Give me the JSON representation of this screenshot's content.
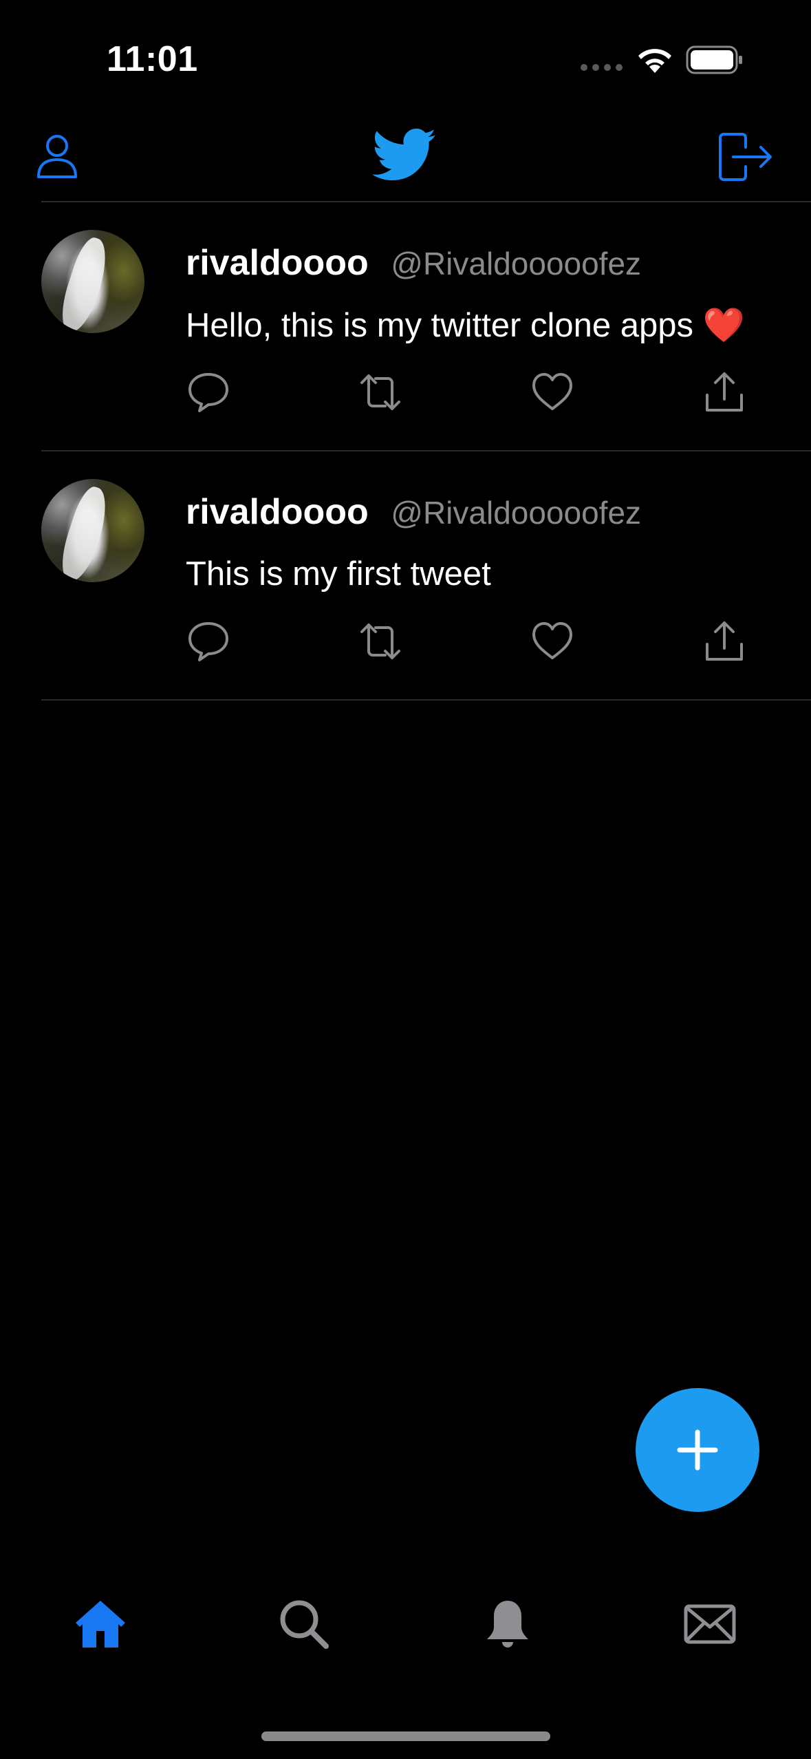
{
  "status_bar": {
    "time": "11:01",
    "icons": [
      "signal-dots-icon",
      "wifi-icon",
      "battery-icon"
    ]
  },
  "top_nav": {
    "left_icon": "profile-icon",
    "center_icon": "twitter-bird-logo",
    "right_icon": "logout-icon",
    "accent_color": "#1d9bf0"
  },
  "tweets": [
    {
      "name": "rivaldoooo",
      "handle": "@Rivaldooooofez",
      "text": "Hello, this is my twitter clone apps ❤️",
      "actions": [
        "comment-icon",
        "retweet-icon",
        "like-icon",
        "share-icon"
      ]
    },
    {
      "name": "rivaldoooo",
      "handle": "@Rivaldooooofez",
      "text": "This is my first tweet",
      "actions": [
        "comment-icon",
        "retweet-icon",
        "like-icon",
        "share-icon"
      ]
    }
  ],
  "compose_button": {
    "icon": "plus-icon",
    "color": "#1d9bf0"
  },
  "tab_bar": {
    "tabs": [
      {
        "icon": "home-icon",
        "active": true
      },
      {
        "icon": "search-icon",
        "active": false
      },
      {
        "icon": "bell-icon",
        "active": false
      },
      {
        "icon": "mail-icon",
        "active": false
      }
    ],
    "active_color": "#1877f2",
    "inactive_color": "#8e8e93"
  }
}
